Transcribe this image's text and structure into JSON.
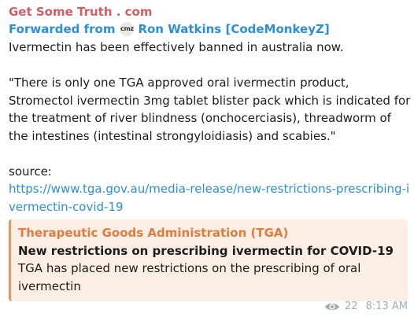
{
  "message": {
    "sender": "Get Some Truth . com",
    "forwarded": {
      "label": "Forwarded from",
      "avatar_text": "cmz",
      "from_name": "Ron Watkins [CodeMonkeyZ]"
    },
    "paragraph1": "Ivermectin has been effectively banned in australia now.",
    "paragraph2": "\"There is only one TGA approved oral ivermectin product, Stromectol ivermectin 3mg tablet blister pack which is indicated for the treatment of river blindness (onchocerciasis), threadworm of the intestines (intestinal strongyloidiasis) and scabies.\"",
    "source_label": "source:",
    "link": "https://www.tga.gov.au/media-release/new-restrictions-prescribing-ivermectin-covid-19"
  },
  "preview": {
    "site": "Therapeutic Goods Administration (TGA)",
    "title": "New restrictions on prescribing ivermectin for COVID-19",
    "description": "TGA has placed new restrictions on the prescribing of oral ivermectin"
  },
  "meta": {
    "views": "22",
    "time": "8:13 AM",
    "icon": "eye-icon"
  },
  "colors": {
    "sender": "#d45d65",
    "link": "#2b8fd8",
    "preview_accent": "#e8925a",
    "preview_bg": "#fbeee5",
    "meta": "#a0acb6"
  }
}
